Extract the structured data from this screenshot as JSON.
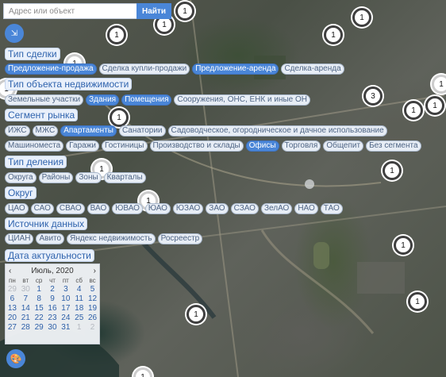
{
  "search": {
    "placeholder": "Адрес или объект",
    "button_label": "Найти"
  },
  "filters": {
    "deal_type": {
      "title": "Тип сделки",
      "options": [
        {
          "label": "Предложение-продажа",
          "selected": true
        },
        {
          "label": "Сделка купли-продажи",
          "selected": false
        },
        {
          "label": "Предложение-аренда",
          "selected": true
        },
        {
          "label": "Сделка-аренда",
          "selected": false
        }
      ]
    },
    "object_type": {
      "title": "Тип объекта недвижимости",
      "options": [
        {
          "label": "Земельные участки",
          "selected": false
        },
        {
          "label": "Здания",
          "selected": true
        },
        {
          "label": "Помещения",
          "selected": true
        },
        {
          "label": "Сооружения, ОНС, ЕНК и иные ОН",
          "selected": false
        }
      ]
    },
    "market_segment": {
      "title": "Сегмент рынка",
      "rows": [
        [
          {
            "label": "ИЖС",
            "selected": false
          },
          {
            "label": "МЖС",
            "selected": false
          },
          {
            "label": "Апартаменты",
            "selected": true
          },
          {
            "label": "Санатории",
            "selected": false
          },
          {
            "label": "Садоводческое, огородническое и дачное использование",
            "selected": false
          }
        ],
        [
          {
            "label": "Машиноместа",
            "selected": false
          },
          {
            "label": "Гаражи",
            "selected": false
          },
          {
            "label": "Гостиницы",
            "selected": false
          },
          {
            "label": "Производство и склады",
            "selected": false
          },
          {
            "label": "Офисы",
            "selected": true
          },
          {
            "label": "Торговля",
            "selected": false
          },
          {
            "label": "Общепит",
            "selected": false
          },
          {
            "label": "Без сегмента",
            "selected": false
          }
        ]
      ]
    },
    "division_type": {
      "title": "Тип деления",
      "options": [
        {
          "label": "Округа",
          "selected": false
        },
        {
          "label": "Районы",
          "selected": false
        },
        {
          "label": "Зоны",
          "selected": false
        },
        {
          "label": "Кварталы",
          "selected": false
        }
      ]
    },
    "district": {
      "title": "Округ",
      "options": [
        {
          "label": "ЦАО",
          "selected": false
        },
        {
          "label": "САО",
          "selected": false
        },
        {
          "label": "СВАО",
          "selected": false
        },
        {
          "label": "ВАО",
          "selected": false
        },
        {
          "label": "ЮВАО",
          "selected": false
        },
        {
          "label": "ЮАО",
          "selected": false
        },
        {
          "label": "ЮЗАО",
          "selected": false
        },
        {
          "label": "ЗАО",
          "selected": false
        },
        {
          "label": "СЗАО",
          "selected": false
        },
        {
          "label": "ЗелАО",
          "selected": false
        },
        {
          "label": "НАО",
          "selected": false
        },
        {
          "label": "ТАО",
          "selected": false
        }
      ]
    },
    "data_source": {
      "title": "Источник данных",
      "options": [
        {
          "label": "ЦИАН",
          "selected": false
        },
        {
          "label": "Авито",
          "selected": false
        },
        {
          "label": "Яндекс недвижимость",
          "selected": false
        },
        {
          "label": "Росреестр",
          "selected": false
        }
      ]
    },
    "relevance_date": {
      "title": "Дата актуальности"
    }
  },
  "calendar": {
    "month_label": "Июль, 2020",
    "prev_icon": "chevron-left-icon",
    "next_icon": "chevron-right-icon",
    "weekdays": [
      "пн",
      "вт",
      "ср",
      "чт",
      "пт",
      "сб",
      "вс"
    ],
    "days": [
      "29",
      "30",
      "1",
      "2",
      "3",
      "4",
      "5",
      "6",
      "7",
      "8",
      "9",
      "10",
      "11",
      "12",
      "13",
      "14",
      "15",
      "16",
      "17",
      "18",
      "19",
      "20",
      "21",
      "22",
      "23",
      "24",
      "25",
      "26",
      "27",
      "28",
      "29",
      "30",
      "31",
      "1",
      "2"
    ],
    "other_month_indices": [
      0,
      1,
      33,
      34
    ]
  },
  "map": {
    "markers": [
      {
        "count": "1"
      },
      {
        "count": "1"
      },
      {
        "count": "1"
      },
      {
        "count": "1"
      },
      {
        "count": "1"
      },
      {
        "count": "1"
      },
      {
        "count": "1"
      },
      {
        "count": "3"
      },
      {
        "count": "1"
      },
      {
        "count": "1"
      },
      {
        "count": "1"
      },
      {
        "count": "1"
      },
      {
        "count": "1"
      },
      {
        "count": "1"
      },
      {
        "count": "1"
      },
      {
        "count": "1"
      },
      {
        "count": "1"
      },
      {
        "count": "1"
      },
      {
        "count": "1"
      }
    ]
  },
  "icons": {
    "collapse": "collapse-arrows-icon",
    "palette": "palette-icon"
  },
  "colors": {
    "accent": "#4a86d8",
    "chip_bg": "#e7edf5",
    "chip_border": "#a9b8cc",
    "heading_text": "#2f63ad"
  }
}
